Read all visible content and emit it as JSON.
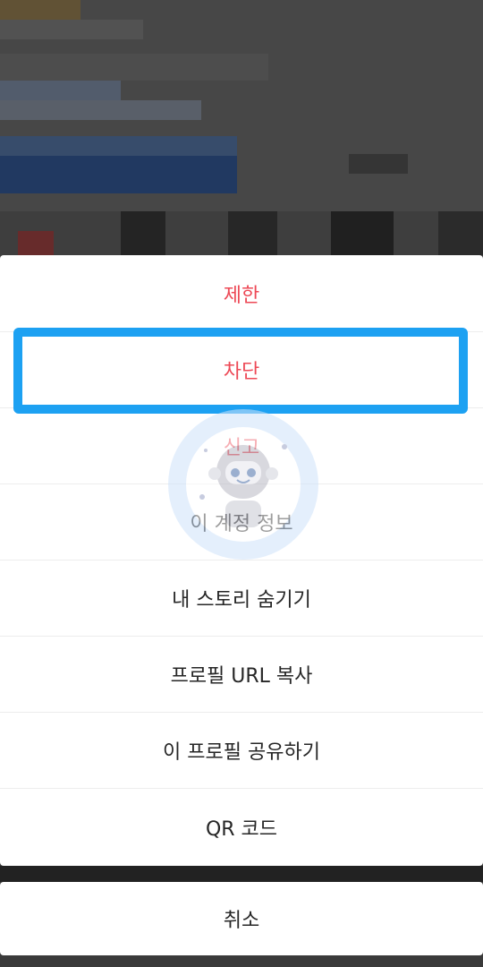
{
  "background": {
    "note_colors": {
      "overlay": "#000000",
      "sheet_bg": "#ffffff",
      "danger": "#ed4956",
      "highlight": "#1da1f2"
    }
  },
  "action_sheet": {
    "items": [
      {
        "label": "제한",
        "style": "danger"
      },
      {
        "label": "차단",
        "style": "danger",
        "highlighted": true
      },
      {
        "label": "신고",
        "style": "danger"
      },
      {
        "label": "이 계정 정보",
        "style": "normal"
      },
      {
        "label": "내 스토리 숨기기",
        "style": "normal"
      },
      {
        "label": "프로필 URL 복사",
        "style": "normal"
      },
      {
        "label": "이 프로필 공유하기",
        "style": "normal"
      },
      {
        "label": "QR 코드",
        "style": "normal"
      }
    ]
  },
  "cancel": {
    "label": "취소"
  },
  "watermark": {
    "icon": "robot-astronaut-icon"
  }
}
